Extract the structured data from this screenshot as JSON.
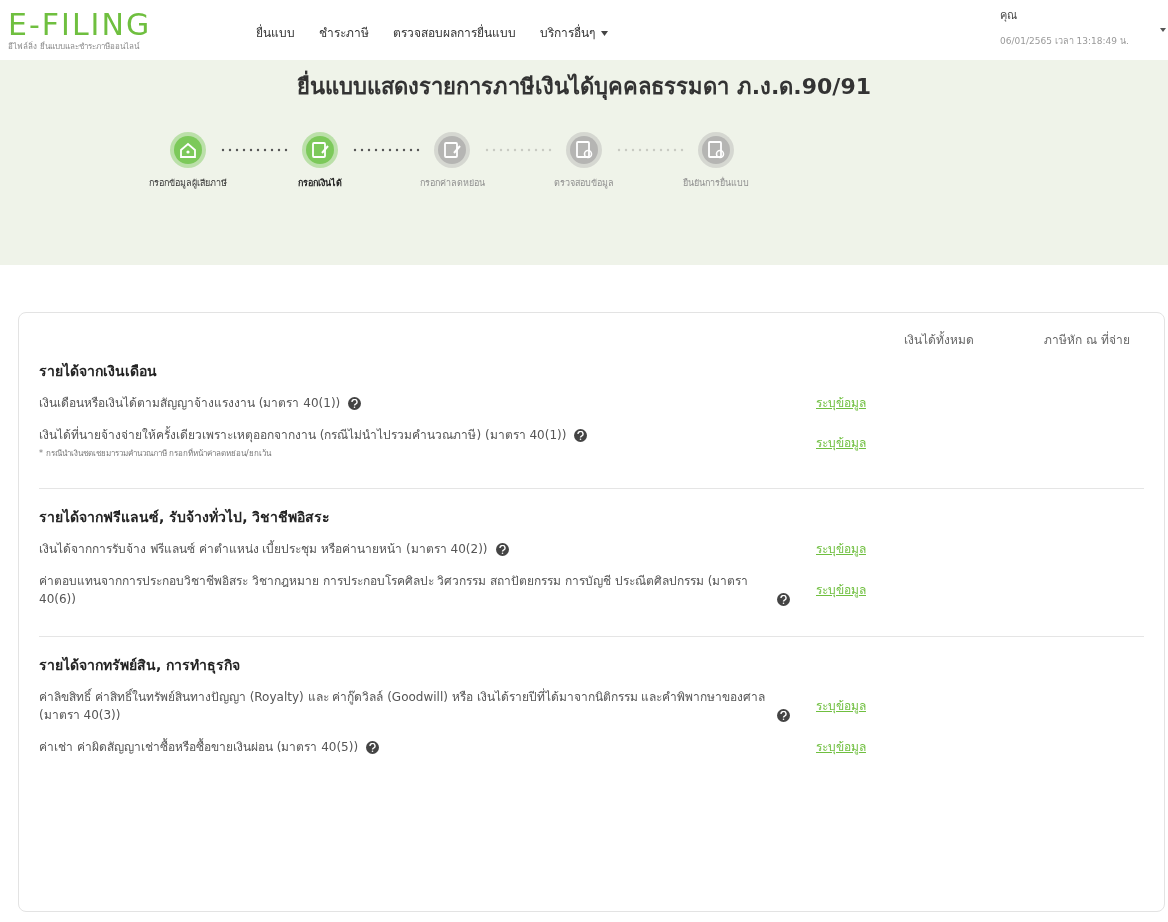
{
  "header": {
    "logo": "E-FILING",
    "tagline": "อีไฟล์ลิ่ง ยื่นแบบและชำระภาษีออนไลน์",
    "nav": [
      {
        "label": "ยื่นแบบ",
        "dropdown": false
      },
      {
        "label": "ชำระภาษี",
        "dropdown": false
      },
      {
        "label": "ตรวจสอบผลการยื่นแบบ",
        "dropdown": false
      },
      {
        "label": "บริการอื่นๆ",
        "dropdown": true
      }
    ],
    "user": "คุณ",
    "datetime": "06/01/2565 เวลา 13:18:49 น."
  },
  "title": "ยื่นแบบแสดงรายการภาษีเงินได้บุคคลธรรมดา ภ.ง.ด.90/91",
  "steps": [
    {
      "label": "กรอกข้อมูลผู้เสียภาษี",
      "completed": true,
      "selected": false,
      "kind": "home"
    },
    {
      "label": "กรอกเงินได้",
      "completed": true,
      "selected": true,
      "kind": "form"
    },
    {
      "label": "กรอกค่าลดหย่อน",
      "completed": false,
      "selected": false,
      "kind": "form"
    },
    {
      "label": "ตรวจสอบข้อมูล",
      "completed": false,
      "selected": false,
      "kind": "review"
    },
    {
      "label": "ยืนยันการยื่นแบบ",
      "completed": false,
      "selected": false,
      "kind": "review"
    }
  ],
  "columns": [
    "เงินได้ทั้งหมด",
    "ภาษีหัก ณ ที่จ่าย"
  ],
  "sections": [
    {
      "title": "รายได้จากเงินเดือน",
      "rows": [
        {
          "text": "เงินเดือนหรือเงินได้ตามสัญญาจ้างแรงงาน (มาตรา 40(1))",
          "link": "ระบุข้อมูล"
        },
        {
          "text": "เงินได้ที่นายจ้างจ่ายให้ครั้งเดียวเพราะเหตุออกจากงาน (กรณีไม่นำไปรวมคำนวณภาษี) (มาตรา 40(1))",
          "link": "ระบุข้อมูล",
          "note": "* กรณีนำเงินชดเชยมารวมคำนวณภาษี กรอกที่หน้าค่าลดหย่อน/ยกเว้น"
        }
      ]
    },
    {
      "title": "รายได้จากฟรีแลนซ์, รับจ้างทั่วไป, วิชาชีพอิสระ",
      "rows": [
        {
          "text": "เงินได้จากการรับจ้าง ฟรีแลนซ์ ค่าตำแหน่ง เบี้ยประชุม หรือค่านายหน้า (มาตรา 40(2))",
          "link": "ระบุข้อมูล"
        },
        {
          "text": "ค่าตอบแทนจากการประกอบวิชาชีพอิสระ วิชากฎหมาย การประกอบโรคศิลปะ วิศวกรรม สถาปัตยกรรม การบัญชี ประณีตศิลปกรรม (มาตรา 40(6))",
          "link": "ระบุข้อมูล"
        }
      ]
    },
    {
      "title": "รายได้จากทรัพย์สิน, การทำธุรกิจ",
      "rows": [
        {
          "text": "ค่าลิขสิทธิ์ ค่าสิทธิ์ในทรัพย์สินทางปัญญา (Royalty) และ ค่ากู๊ดวิลล์ (Goodwill) หรือ เงินได้รายปีที่ได้มาจากนิติกรรม และคำพิพากษาของศาล (มาตรา 40(3))",
          "link": "ระบุข้อมูล"
        },
        {
          "text": "ค่าเช่า ค่าผิดสัญญาเช่าซื้อหรือซื้อขายเงินผ่อน (มาตรา 40(5))",
          "link": "ระบุข้อมูล"
        }
      ]
    }
  ]
}
